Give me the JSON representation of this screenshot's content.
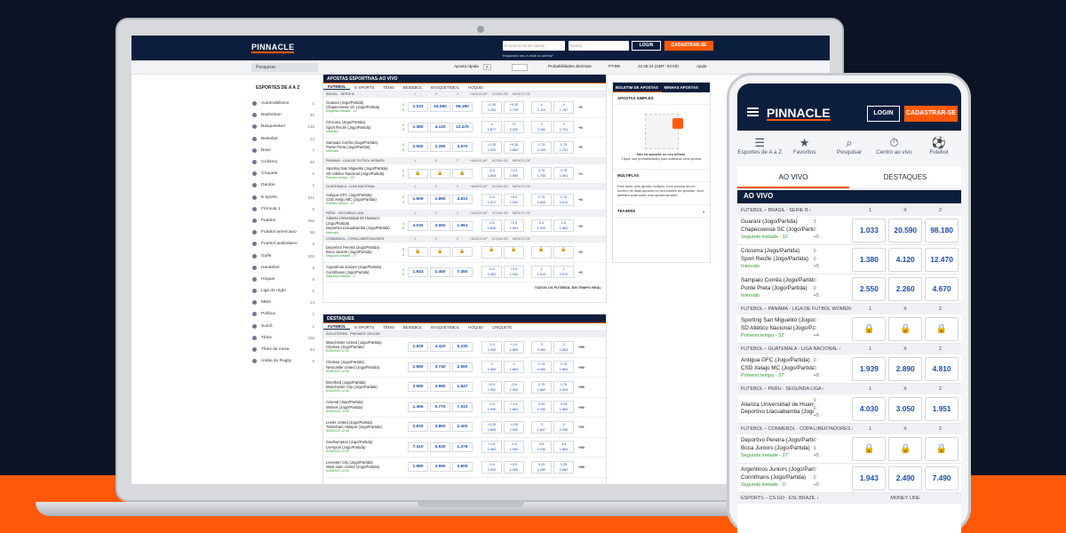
{
  "header": {
    "logo": "PINNACLE",
    "email_placeholder": "E-mail ou ID de cliente",
    "password_placeholder": "Senha",
    "login_label": "LOGIN",
    "register_label": "CADASTRAR-SE",
    "forgot_text": "Esqueceu seu e-mail ou senha?"
  },
  "subheader": {
    "search_placeholder": "Pesquisar",
    "quick_bet": "Aposta rápida",
    "quick_bet_value": "0",
    "odds_format": "Probabilidades decimais",
    "language": "PT-BR",
    "time": "22:48:24 (GMT -03:00)",
    "help": "Ajuda"
  },
  "sidebar": {
    "title": "ESPORTES DE A A Z",
    "items": [
      {
        "name": "Automobilismo",
        "count": "1"
      },
      {
        "name": "Badminton",
        "count": "40"
      },
      {
        "name": "Basquetebol",
        "count": "133"
      },
      {
        "name": "Beisebol",
        "count": "24"
      },
      {
        "name": "Boxe",
        "count": "7"
      },
      {
        "name": "Ciclismo",
        "count": "83"
      },
      {
        "name": "Críquete",
        "count": "5"
      },
      {
        "name": "Dardos",
        "count": "2"
      },
      {
        "name": "E-sports",
        "count": "241"
      },
      {
        "name": "Fórmula 1",
        "count": "5"
      },
      {
        "name": "Futebol",
        "count": "656"
      },
      {
        "name": "Futebol americano",
        "count": "68"
      },
      {
        "name": "Futebol australiano",
        "count": "9"
      },
      {
        "name": "Golfe",
        "count": "202"
      },
      {
        "name": "Handebol",
        "count": "5"
      },
      {
        "name": "Hóquei",
        "count": "5"
      },
      {
        "name": "Liga de rúgbi",
        "count": "5"
      },
      {
        "name": "MMA",
        "count": "24"
      },
      {
        "name": "Política",
        "count": "1"
      },
      {
        "name": "Sumô",
        "count": "1"
      },
      {
        "name": "Tênis",
        "count": "195"
      },
      {
        "name": "Tênis de mesa",
        "count": "54"
      },
      {
        "name": "União do Rugby",
        "count": "5"
      }
    ]
  },
  "live_panel": {
    "title": "APOSTAS ESPORTIVAS-AO VIVO",
    "tabs": [
      "FUTEBOL",
      "E-SPORTS",
      "TÊNIS",
      "BEISEBOL",
      "BASQUETEBOL",
      "HÓQUEI"
    ],
    "footer": "TODOS OS FUTEBOL EM TEMPO REAL",
    "col_1": "1",
    "col_x": "X",
    "col_2": "2",
    "col_hcp": "HANDICAP",
    "col_over": "ACIMA DE",
    "col_under": "MENOS DE",
    "leagues": [
      {
        "name": "BRASIL - SÉRIE B",
        "matches": [
          {
            "home": "Guarani (Jogo/Partida)",
            "away": "Chapecoense SC (Jogo/Partida)",
            "status": "Segunda metade - 11'",
            "s1": "3",
            "s2": "0",
            "o1": "1.033",
            "ox": "20.590",
            "o2": "98.180",
            "h1": "-0.25 / 2.260",
            "h2": "+0.25 / 1.709",
            "ov": "4 / 2.110",
            "un": "4 / 1.787",
            "more": "+9"
          },
          {
            "home": "Criciuma (Jogo/Partida)",
            "away": "Sport Recife (Jogo/Partida)",
            "status": "Intervalo",
            "s1": "0",
            "s2": "0",
            "o1": "1.380",
            "ox": "4.120",
            "o2": "12.470",
            "h1": "-1 / 1.877",
            "h2": "+1 / 2.020",
            "ov": "2 / 2.160",
            "un": "2 / 1.751",
            "more": "+5"
          },
          {
            "home": "Sampaio Corrêa (Jogo/Partida)",
            "away": "Ponte Preta (Jogo/Partida)",
            "status": "Intervalo",
            "s1": "0",
            "s2": "0",
            "o1": "2.550",
            "ox": "2.260",
            "o2": "4.670",
            "h1": "-0.25 / 2.030",
            "h2": "+0.25 / 1.862",
            "ov": "1.75 / 2.160",
            "un": "1.75 / 1.751",
            "more": "+5"
          }
        ]
      },
      {
        "name": "PANAMA - LIGA DE FUTBOL WOMEN",
        "matches": [
          {
            "home": "Sporting San Miguelito (Jogo/Partida)",
            "away": "SD Atlético Nacional (Jogo/Partida)",
            "status": "Primeiro tempo - 32'",
            "s1": "0",
            "s2": "0",
            "o1": "",
            "ox": "",
            "o2": "",
            "h1": "-2.5 / 1.854",
            "h2": "+2.5 / 1.854",
            "ov": "4.75 / 1.763",
            "un": "4.75 / 1.961",
            "more": "+4"
          }
        ]
      },
      {
        "name": "GUATEMALA - LIGA NACIONAL",
        "matches": [
          {
            "home": "Antigua GFC (Jogo/Partida)",
            "away": "CSD Xelajú MC (Jogo/Partida)",
            "status": "Primeiro tempo - 37'",
            "s1": "0",
            "s2": "0",
            "o1": "1.909",
            "ox": "2.890",
            "o2": "4.810",
            "h1": "-0.5 / 1.917",
            "h2": "+0.5 / 1.900",
            "ov": "1.75 / 1.800",
            "un": "1.75 / 2.010",
            "more": "+8"
          }
        ]
      },
      {
        "name": "PERU - SEGUNDA LIGA",
        "matches": [
          {
            "home": "Alianza Universidad de Huanuco (Jogo/Partida)",
            "away": "Deportivo Llacuabamba (Jogo/Partida)",
            "status": "Intervalo",
            "s1": "1",
            "s2": "0",
            "o1": "4.030",
            "ox": "3.050",
            "o2": "1.961",
            "h1": "-0.5 / 1.826",
            "h2": "+0.5 / 1.961",
            "ov": "2.5 / 1.925",
            "un": "2.5 / 1.862",
            "more": "+5"
          }
        ]
      },
      {
        "name": "CONMEBOL - COPA LIBERTADORES",
        "matches": [
          {
            "home": "Deportivo Pereira (Jogo/Partida)",
            "away": "Boca Juniors (Jogo/Partida)",
            "status": "Segunda metade - 27'",
            "s1": "0",
            "s2": "1",
            "o1": "",
            "ox": "",
            "o2": "",
            "h1": "",
            "h2": "",
            "ov": "",
            "un": "",
            "more": "+5"
          },
          {
            "home": "Argentinos Juniors (Jogo/Partida)",
            "away": "Corinthians (Jogo/Partida)",
            "status": "Segunda metade - 0'",
            "s1": "0",
            "s2": "0",
            "o1": "1.943",
            "ox": "2.450",
            "o2": "7.450",
            "h1": "-0.5 / 1.952",
            "h2": "+0.5 / 1.934",
            "ov": "1 / 1.819",
            "un": "1 / 2.070",
            "more": "+5"
          }
        ]
      }
    ]
  },
  "highlights_panel": {
    "title": "DESTAQUES",
    "tabs": [
      "FUTEBOL",
      "E-SPORTS",
      "TÊNIS",
      "BEISEBOL",
      "BASQUETEBOL",
      "HÓQUEI",
      "CRÍQUETE"
    ],
    "league": "INGLATERRA - PREMIER LEAGUE",
    "matches": [
      {
        "home": "Manchester United (Jogo/Partida)",
        "away": "Chelsea (Jogo/Partida)",
        "date": "5/25/2023 12:00",
        "o1": "1.628",
        "ox": "4.420",
        "o2": "5.230",
        "h1": "-1.0 / 2.050",
        "h2": "+1.0 / 1.862",
        "ov": "3 / 2.050",
        "un": "3 / 1.862",
        "more": "+59"
      },
      {
        "home": "Chelsea (Jogo/Partida)",
        "away": "Newcastle United (Jogo/Partida)",
        "date": "5/28/2023 12:00",
        "o1": "2.680",
        "ox": "3.740",
        "o2": "2.560",
        "h1": "0 / 2.050",
        "h2": "0 / 1.862",
        "ov": "2.75 / 2.050",
        "un": "2.75 / 1.862",
        "more": "+59"
      },
      {
        "home": "Brentford (Jogo/Partida)",
        "away": "Manchester City (Jogo/Partida)",
        "date": "5/28/2023 12:00",
        "o1": "3.980",
        "ox": "3.980",
        "o2": "1.847",
        "h1": "+0.5 / 1.952",
        "h2": "-0.5 / 1.900",
        "ov": "2.75 / 1.862",
        "un": "2.75 / 1.925",
        "more": "+59"
      },
      {
        "home": "Arsenal (Jogo/Partida)",
        "away": "Wolves (Jogo/Partida)",
        "date": "5/28/2023 12:00",
        "o1": "1.366",
        "ox": "5.770",
        "o2": "7.510",
        "h1": "-1.5 / 1.990",
        "h2": "+1.5 / 1.862",
        "ov": "3.25 / 2.030",
        "un": "3.25 / 1.862",
        "more": "+59"
      },
      {
        "home": "Leeds United (Jogo/Partida)",
        "away": "Tottenham Hotspur (Jogo/Partida)",
        "date": "5/28/2023 12:00",
        "o1": "2.830",
        "ox": "3.860",
        "o2": "2.400",
        "h1": "+0.25 / 1.806",
        "h2": "-0.25 / 2.050",
        "ov": "3 / 1.847",
        "un": "3 / 2.030",
        "more": "+57"
      },
      {
        "home": "Southampton (Jogo/Partida)",
        "away": "Liverpool (Jogo/Partida)",
        "date": "5/28/2023 12:00",
        "o1": "7.410",
        "ox": "5.630",
        "o2": "1.378",
        "h1": "+1.5 / 1.892",
        "h2": "-1.5 / 1.990",
        "ov": "3.5 / 2.030",
        "un": "3.5 / 1.862",
        "more": "+59"
      },
      {
        "home": "Leicester City (Jogo/Partida)",
        "away": "West Ham United (Jogo/Partida)",
        "date": "5/28/2023 12:00",
        "o1": "1.980",
        "ox": "3.990",
        "o2": "3.600",
        "h1": "-0.5 / 2.000",
        "h2": "+0.5 / 1.900",
        "ov": "3.25 / 2.050",
        "un": "3.25 / 1.862",
        "more": "+59"
      }
    ]
  },
  "betslip": {
    "tab_slip": "BOLETIM DE APOSTAS",
    "tab_mine": "MINHAS APOSTAS",
    "single": "APOSTAS SIMPLES",
    "empty_title": "Não há apostas no seu bilhete.",
    "empty_sub": "Clique nas probabilidades para adicionar uma aposta.",
    "multiple": "MÚLTIPLAS",
    "multiple_text": "Para fazer uma aposta múltipla, você precisa de um mínimo de duas apostas no seu boletim de apostas. Você também pode fazer uma aposta simples.",
    "teasers": "TEASERS"
  },
  "phone": {
    "logo": "PINNACLE",
    "login": "LOGIN",
    "register": "CADASTRAR-SE",
    "nav": [
      {
        "icon": "list-icon",
        "glyph": "☰",
        "label": "Esportes de A a Z"
      },
      {
        "icon": "star-icon",
        "glyph": "★",
        "label": "Favoritos"
      },
      {
        "icon": "search-icon",
        "glyph": "⌕",
        "label": "Pesquisar"
      },
      {
        "icon": "stopwatch-icon",
        "glyph": "⏱",
        "label": "Centro ao vivo"
      },
      {
        "icon": "football-icon",
        "glyph": "⚽",
        "label": "Futebol"
      }
    ],
    "tab_live": "AO VIVO",
    "tab_highlights": "DESTAQUES",
    "live_header": "AO VIVO",
    "col_1": "1",
    "col_x": "X",
    "col_2": "2",
    "groups": [
      {
        "league": "FUTEBOL – BRASIL - SÉRIE B",
        "rows": [
          {
            "home": "Guarani (Jogo/Partida)",
            "away": "Chapecoense SC (Jogo/Partida)",
            "status": "Segunda metade - 11'",
            "s1": "3",
            "s2": "0",
            "plus": "+5",
            "o1": "1.033",
            "ox": "20.590",
            "o2": "98.180"
          },
          {
            "home": "Criciuma (Jogo/Partida)",
            "away": "Sport Recife (Jogo/Partida)",
            "status": "Intervalo",
            "s1": "0",
            "s2": "0",
            "plus": "+5",
            "o1": "1.380",
            "ox": "4.120",
            "o2": "12.470"
          },
          {
            "home": "Sampaio Corrêa (Jogo/Partida)",
            "away": "Ponte Preta (Jogo/Partida)",
            "status": "Intervalo",
            "s1": "0",
            "s2": "0",
            "plus": "+5",
            "o1": "2.550",
            "ox": "2.260",
            "o2": "4.670"
          }
        ]
      },
      {
        "league": "FUTEBOL – PANAMA - LIGA DE FUTBOL WOMEN",
        "rows": [
          {
            "home": "Sporting San Miguelito (Jogo/Partida)",
            "away": "SD Atlético Nacional (Jogo/Partida)",
            "status": "Primeiro tempo - 32'",
            "s1": "0",
            "s2": "0",
            "plus": "+4",
            "o1": "",
            "ox": "",
            "o2": ""
          }
        ]
      },
      {
        "league": "FUTEBOL – GUATEMALA - LIGA NACIONAL",
        "rows": [
          {
            "home": "Antigua GFC (Jogo/Partida)",
            "away": "CSD Xelajú MC (Jogo/Partida)",
            "status": "Primeiro tempo - 37'",
            "s1": "0",
            "s2": "0",
            "plus": "+8",
            "o1": "1.939",
            "ox": "2.890",
            "o2": "4.810"
          }
        ]
      },
      {
        "league": "FUTEBOL – PERU - SEGUNDA LIGA",
        "rows": [
          {
            "home": "Alianza Universidad de Huanuco (Jogo/Partida)",
            "away": "Deportivo Llacuabamba (Jogo/Partida)",
            "status": "",
            "s1": "1",
            "s2": "0",
            "plus": "+5",
            "o1": "4.030",
            "ox": "3.050",
            "o2": "1.951"
          }
        ]
      },
      {
        "league": "FUTEBOL – CONMEBOL - COPA LIBERTADORES",
        "rows": [
          {
            "home": "Deportivo Pereira (Jogo/Partida)",
            "away": "Boca Juniors (Jogo/Partida)",
            "status": "Segunda metade - 27'",
            "s1": "0",
            "s2": "1",
            "plus": "+5",
            "o1": "",
            "ox": "",
            "o2": ""
          },
          {
            "home": "Argentinos Juniors (Jogo/Partida)",
            "away": "Corinthians (Jogo/Partida)",
            "status": "Segunda metade - 0'",
            "s1": "0",
            "s2": "0",
            "plus": "+5",
            "o1": "1.943",
            "ox": "2.490",
            "o2": "7.490"
          }
        ]
      }
    ],
    "last_league": "ESPORTS – CS:GO - ESL BRAZIL",
    "last_col": "MONEY LINE"
  }
}
